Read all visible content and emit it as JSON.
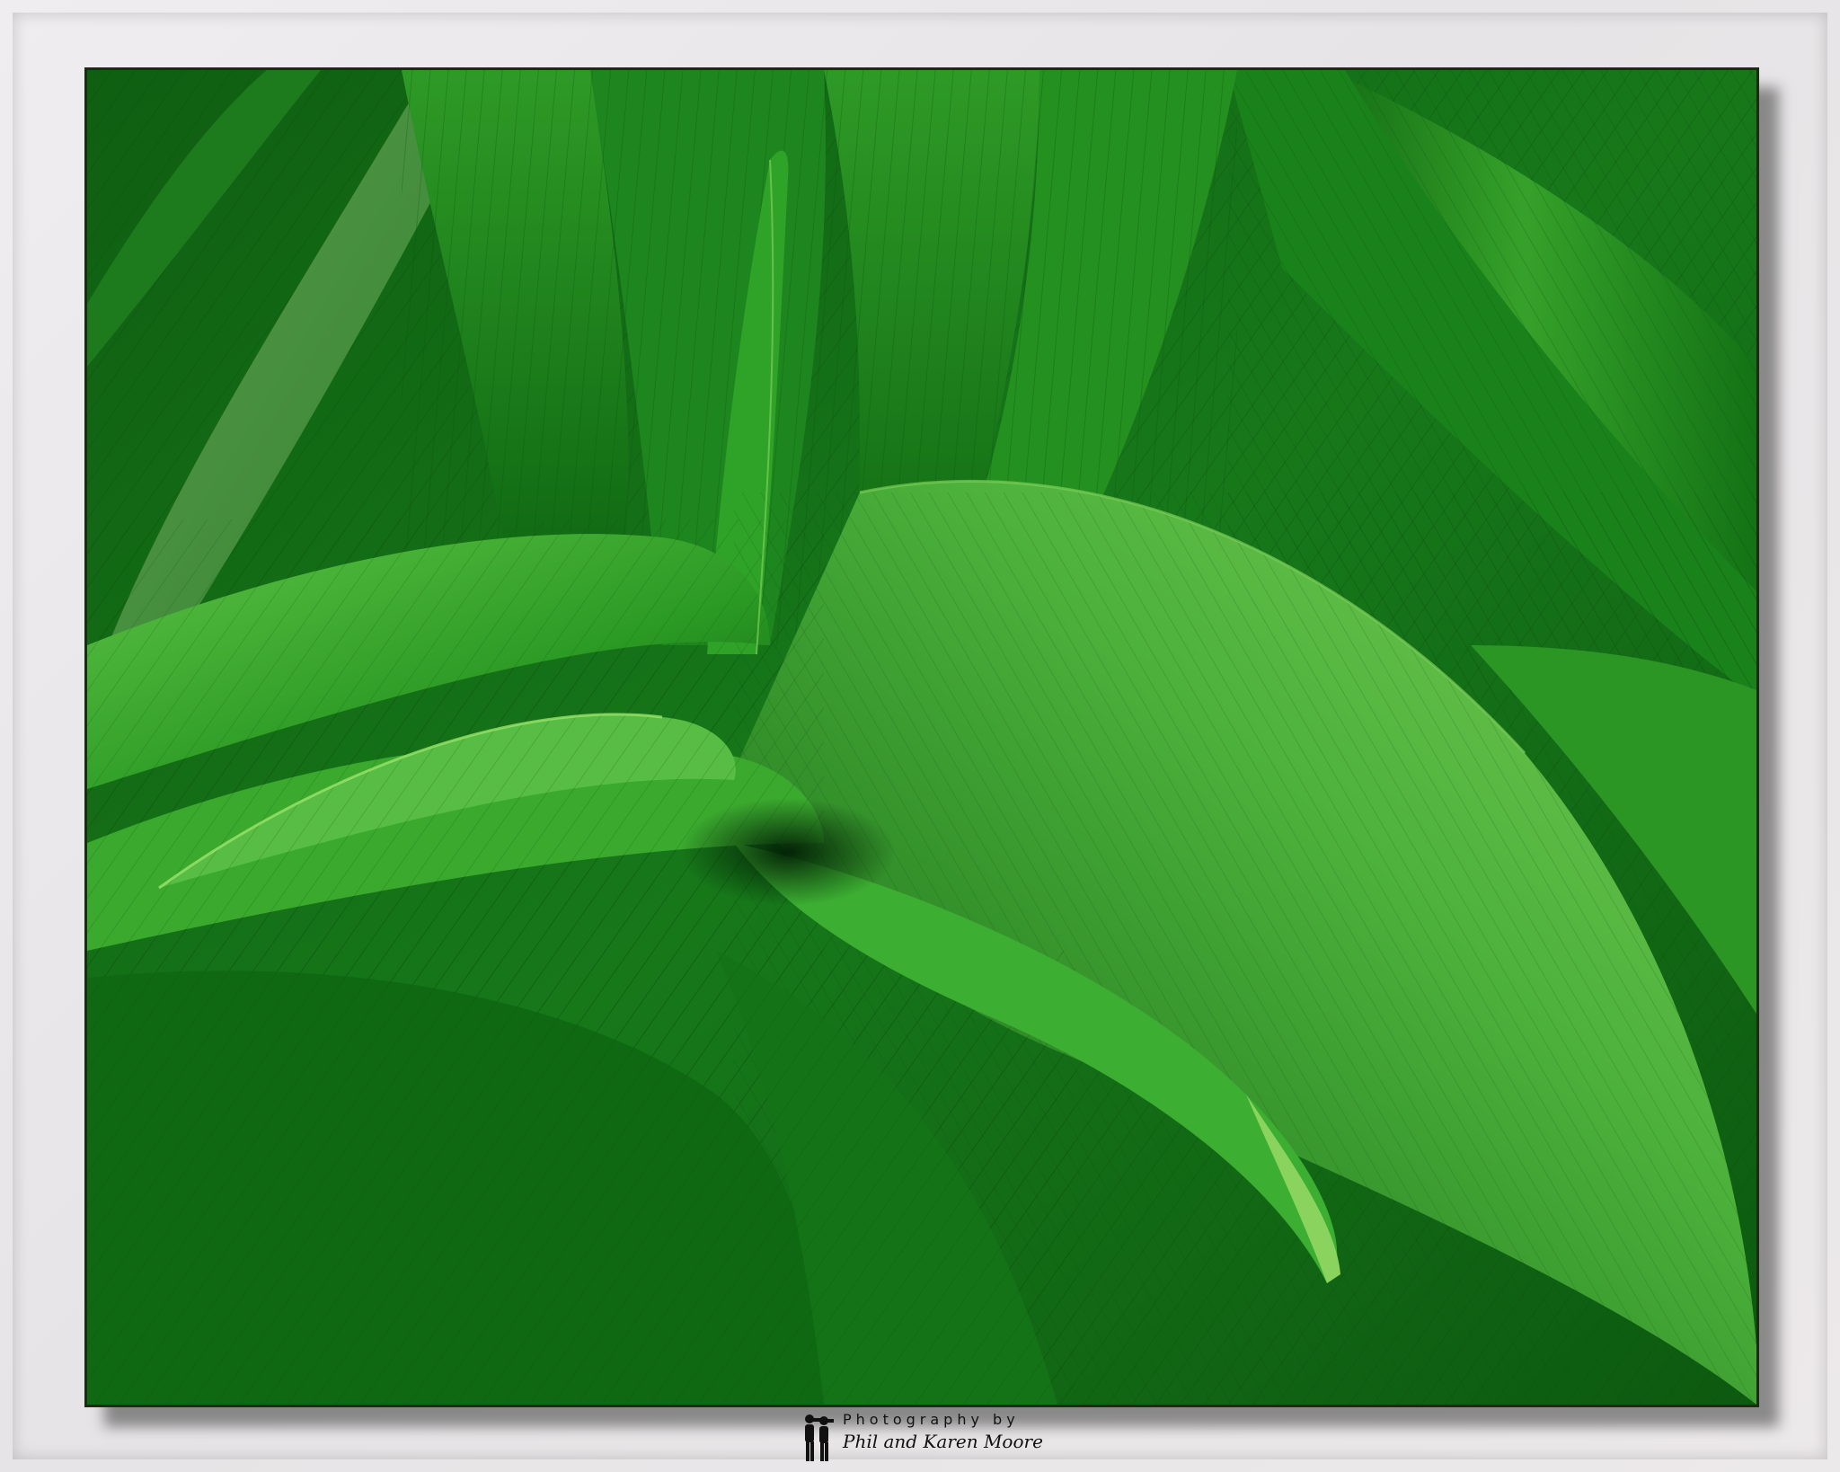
{
  "photo": {
    "subject": "green-leaves-closeup",
    "colors": {
      "base": "#136b14",
      "light": "#4fb53a",
      "highlight": "#8ad35e",
      "dark": "#064308"
    }
  },
  "credit": {
    "icon": "photographers-silhouette-icon",
    "line1": "Photography by",
    "line2": "Phil and Karen Moore"
  }
}
